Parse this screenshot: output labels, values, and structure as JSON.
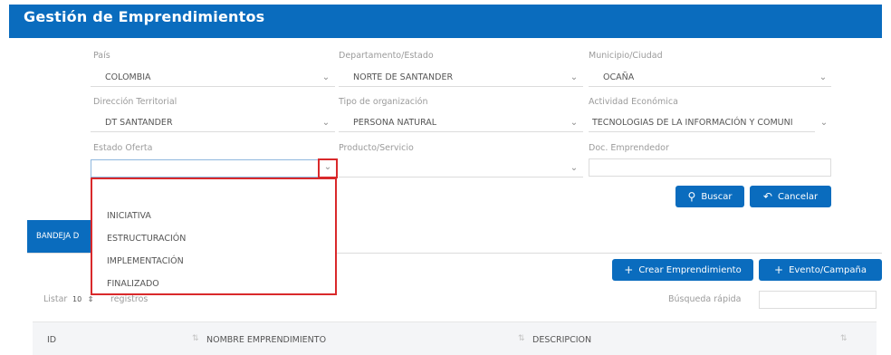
{
  "header": {
    "title": "Gestión de Emprendimientos"
  },
  "filters": {
    "pais": {
      "label": "País",
      "value": "COLOMBIA"
    },
    "departamento": {
      "label": "Departamento/Estado",
      "value": "NORTE DE SANTANDER"
    },
    "municipio": {
      "label": "Municipio/Ciudad",
      "value": "OCAÑA"
    },
    "direccion": {
      "label": "Dirección Territorial",
      "value": "DT SANTANDER"
    },
    "tipo_org": {
      "label": "Tipo de organización",
      "value": "PERSONA NATURAL"
    },
    "actividad": {
      "label": "Actividad Económica",
      "value": "TECNOLOGIAS DE LA INFORMACIÓN Y COMUNI"
    },
    "estado_oferta": {
      "label": "Estado Oferta",
      "value": ""
    },
    "producto": {
      "label": "Producto/Servicio",
      "value": ""
    },
    "doc": {
      "label": "Doc. Emprendedor",
      "value": ""
    }
  },
  "buttons": {
    "buscar": "Buscar",
    "cancelar": "Cancelar",
    "crear": "Crear Emprendimiento",
    "evento": "Evento/Campaña"
  },
  "tab": {
    "label": "BANDEJA D"
  },
  "estado_options": [
    "INICIATIVA",
    "ESTRUCTURACIÓN",
    "IMPLEMENTACIÓN",
    "FINALIZADO"
  ],
  "table": {
    "listar": "Listar",
    "page_size": "10",
    "registros": "registros",
    "search_label": "Búsqueda rápida",
    "columns": [
      "ID",
      "NOMBRE EMPRENDIMIENTO",
      "DESCRIPCION"
    ]
  },
  "icons": {
    "chevron": "chevron-down-icon",
    "search": "search-icon",
    "back": "undo-arrow-icon",
    "plus": "plus-icon"
  },
  "colors": {
    "primary": "#0a6cbe",
    "highlight": "#d9292b"
  }
}
